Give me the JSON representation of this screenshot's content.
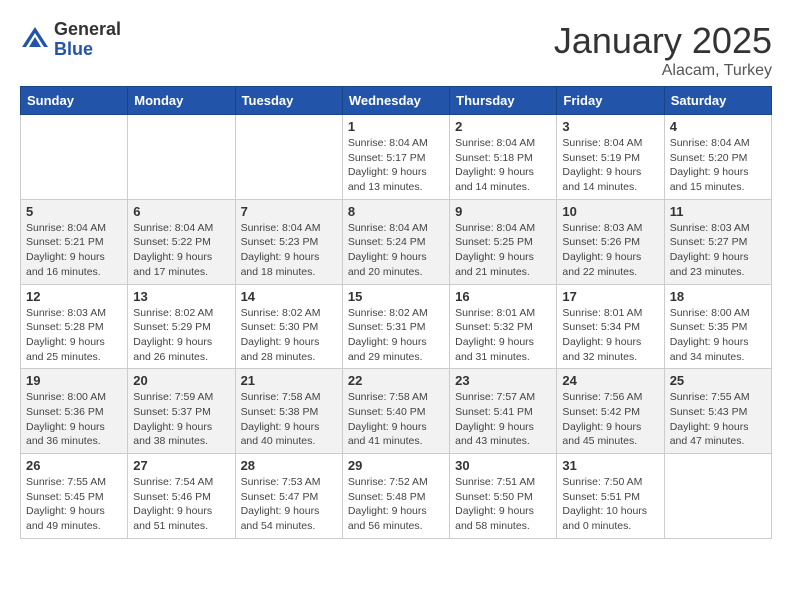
{
  "logo": {
    "general": "General",
    "blue": "Blue"
  },
  "title": "January 2025",
  "location": "Alacam, Turkey",
  "days_of_week": [
    "Sunday",
    "Monday",
    "Tuesday",
    "Wednesday",
    "Thursday",
    "Friday",
    "Saturday"
  ],
  "weeks": [
    [
      {
        "day": "",
        "info": ""
      },
      {
        "day": "",
        "info": ""
      },
      {
        "day": "",
        "info": ""
      },
      {
        "day": "1",
        "info": "Sunrise: 8:04 AM\nSunset: 5:17 PM\nDaylight: 9 hours\nand 13 minutes."
      },
      {
        "day": "2",
        "info": "Sunrise: 8:04 AM\nSunset: 5:18 PM\nDaylight: 9 hours\nand 14 minutes."
      },
      {
        "day": "3",
        "info": "Sunrise: 8:04 AM\nSunset: 5:19 PM\nDaylight: 9 hours\nand 14 minutes."
      },
      {
        "day": "4",
        "info": "Sunrise: 8:04 AM\nSunset: 5:20 PM\nDaylight: 9 hours\nand 15 minutes."
      }
    ],
    [
      {
        "day": "5",
        "info": "Sunrise: 8:04 AM\nSunset: 5:21 PM\nDaylight: 9 hours\nand 16 minutes."
      },
      {
        "day": "6",
        "info": "Sunrise: 8:04 AM\nSunset: 5:22 PM\nDaylight: 9 hours\nand 17 minutes."
      },
      {
        "day": "7",
        "info": "Sunrise: 8:04 AM\nSunset: 5:23 PM\nDaylight: 9 hours\nand 18 minutes."
      },
      {
        "day": "8",
        "info": "Sunrise: 8:04 AM\nSunset: 5:24 PM\nDaylight: 9 hours\nand 20 minutes."
      },
      {
        "day": "9",
        "info": "Sunrise: 8:04 AM\nSunset: 5:25 PM\nDaylight: 9 hours\nand 21 minutes."
      },
      {
        "day": "10",
        "info": "Sunrise: 8:03 AM\nSunset: 5:26 PM\nDaylight: 9 hours\nand 22 minutes."
      },
      {
        "day": "11",
        "info": "Sunrise: 8:03 AM\nSunset: 5:27 PM\nDaylight: 9 hours\nand 23 minutes."
      }
    ],
    [
      {
        "day": "12",
        "info": "Sunrise: 8:03 AM\nSunset: 5:28 PM\nDaylight: 9 hours\nand 25 minutes."
      },
      {
        "day": "13",
        "info": "Sunrise: 8:02 AM\nSunset: 5:29 PM\nDaylight: 9 hours\nand 26 minutes."
      },
      {
        "day": "14",
        "info": "Sunrise: 8:02 AM\nSunset: 5:30 PM\nDaylight: 9 hours\nand 28 minutes."
      },
      {
        "day": "15",
        "info": "Sunrise: 8:02 AM\nSunset: 5:31 PM\nDaylight: 9 hours\nand 29 minutes."
      },
      {
        "day": "16",
        "info": "Sunrise: 8:01 AM\nSunset: 5:32 PM\nDaylight: 9 hours\nand 31 minutes."
      },
      {
        "day": "17",
        "info": "Sunrise: 8:01 AM\nSunset: 5:34 PM\nDaylight: 9 hours\nand 32 minutes."
      },
      {
        "day": "18",
        "info": "Sunrise: 8:00 AM\nSunset: 5:35 PM\nDaylight: 9 hours\nand 34 minutes."
      }
    ],
    [
      {
        "day": "19",
        "info": "Sunrise: 8:00 AM\nSunset: 5:36 PM\nDaylight: 9 hours\nand 36 minutes."
      },
      {
        "day": "20",
        "info": "Sunrise: 7:59 AM\nSunset: 5:37 PM\nDaylight: 9 hours\nand 38 minutes."
      },
      {
        "day": "21",
        "info": "Sunrise: 7:58 AM\nSunset: 5:38 PM\nDaylight: 9 hours\nand 40 minutes."
      },
      {
        "day": "22",
        "info": "Sunrise: 7:58 AM\nSunset: 5:40 PM\nDaylight: 9 hours\nand 41 minutes."
      },
      {
        "day": "23",
        "info": "Sunrise: 7:57 AM\nSunset: 5:41 PM\nDaylight: 9 hours\nand 43 minutes."
      },
      {
        "day": "24",
        "info": "Sunrise: 7:56 AM\nSunset: 5:42 PM\nDaylight: 9 hours\nand 45 minutes."
      },
      {
        "day": "25",
        "info": "Sunrise: 7:55 AM\nSunset: 5:43 PM\nDaylight: 9 hours\nand 47 minutes."
      }
    ],
    [
      {
        "day": "26",
        "info": "Sunrise: 7:55 AM\nSunset: 5:45 PM\nDaylight: 9 hours\nand 49 minutes."
      },
      {
        "day": "27",
        "info": "Sunrise: 7:54 AM\nSunset: 5:46 PM\nDaylight: 9 hours\nand 51 minutes."
      },
      {
        "day": "28",
        "info": "Sunrise: 7:53 AM\nSunset: 5:47 PM\nDaylight: 9 hours\nand 54 minutes."
      },
      {
        "day": "29",
        "info": "Sunrise: 7:52 AM\nSunset: 5:48 PM\nDaylight: 9 hours\nand 56 minutes."
      },
      {
        "day": "30",
        "info": "Sunrise: 7:51 AM\nSunset: 5:50 PM\nDaylight: 9 hours\nand 58 minutes."
      },
      {
        "day": "31",
        "info": "Sunrise: 7:50 AM\nSunset: 5:51 PM\nDaylight: 10 hours\nand 0 minutes."
      },
      {
        "day": "",
        "info": ""
      }
    ]
  ]
}
